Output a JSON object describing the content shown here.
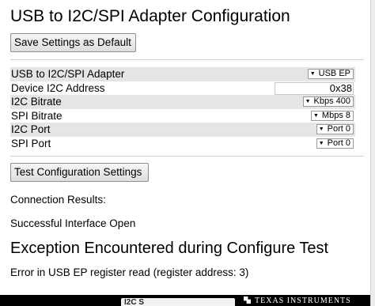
{
  "title": "USB to I2C/SPI Adapter Configuration",
  "save_button": "Save Settings as Default",
  "settings": [
    {
      "label": "USB to I2C/SPI Adapter",
      "type": "select",
      "value": "USB EP"
    },
    {
      "label": "Device I2C Address",
      "type": "input",
      "value": "0x38"
    },
    {
      "label": "I2C Bitrate",
      "type": "select",
      "value": "Kbps 400"
    },
    {
      "label": "SPI Bitrate",
      "type": "select",
      "value": "Mbps 8"
    },
    {
      "label": "I2C Port",
      "type": "select",
      "value": "Port 0"
    },
    {
      "label": "SPI Port",
      "type": "select",
      "value": "Port 0"
    }
  ],
  "test_button": "Test Configuration Settings",
  "connection_results_label": "Connection Results:",
  "connection_result": "Successful Interface Open",
  "exception_heading": "Exception Encountered during Configure Test",
  "error_message": "Error in USB EP register read (register address: 3)",
  "footer": {
    "chip_text": "I2C S",
    "brand": "TEXAS INSTRUMENTS"
  },
  "icons": {
    "select_arrow": "chevron-down-icon",
    "brand_logo": "texas-instruments-logo"
  }
}
